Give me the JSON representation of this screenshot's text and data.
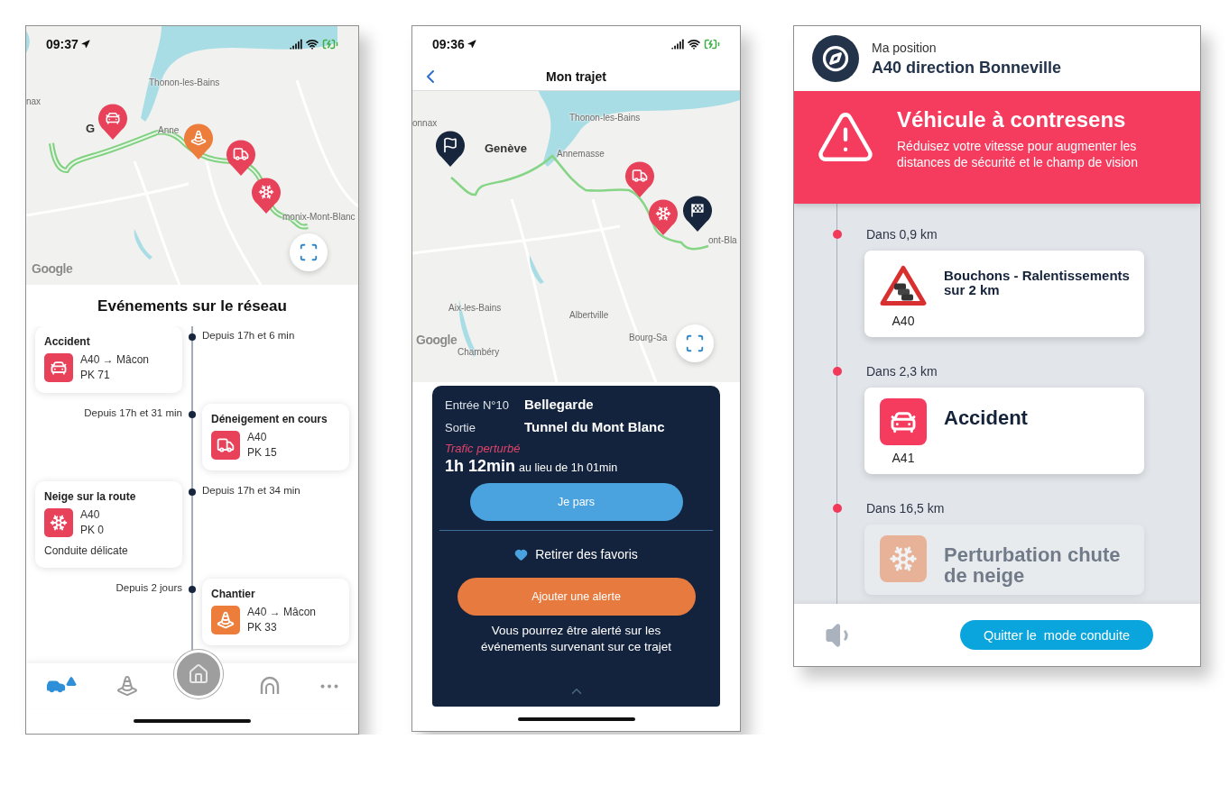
{
  "events_screen": {
    "status_bar": {
      "time": "09:37"
    },
    "map": {
      "labels": [
        {
          "text": "nax",
          "kind": "minor"
        },
        {
          "text": "Thonon-les-Bains",
          "kind": "minor"
        },
        {
          "text": "G",
          "kind": "major"
        },
        {
          "text": "Anne",
          "kind": "minor"
        },
        {
          "text": "monix-Mont-Blanc",
          "kind": "minor"
        }
      ],
      "markers": [
        {
          "kind": "accident"
        },
        {
          "kind": "works"
        },
        {
          "kind": "plow"
        },
        {
          "kind": "snow"
        }
      ],
      "attribution": "Google"
    },
    "title": "Evénements sur le réseau",
    "events": [
      {
        "time": "Depuis 17h et 6 min",
        "title": "Accident",
        "kind": "accident",
        "lines": [
          "A40 → Mâcon",
          "PK 71"
        ]
      },
      {
        "time": "Depuis 17h et 31 min",
        "title": "Déneigement en cours",
        "kind": "plow",
        "lines": [
          "A40",
          "PK 15"
        ]
      },
      {
        "time": "Depuis 17h et 34 min",
        "title": "Neige sur la route",
        "kind": "snow",
        "lines": [
          "A40",
          "PK 0"
        ],
        "note": "Conduite délicate"
      },
      {
        "time": "Depuis 2 jours",
        "title": "Chantier",
        "kind": "works",
        "lines": [
          "A40 → Mâcon",
          "PK 33"
        ]
      }
    ],
    "tabs": [
      {
        "kind": "traffic",
        "selected": true
      },
      {
        "kind": "works",
        "selected": false
      },
      {
        "kind": "home",
        "selected": false
      },
      {
        "kind": "tunnel",
        "selected": false
      },
      {
        "kind": "more",
        "selected": false
      }
    ]
  },
  "trip_screen": {
    "status_bar": {
      "time": "09:36"
    },
    "header": {
      "title": "Mon trajet"
    },
    "map": {
      "labels": [
        {
          "text": "onnax",
          "kind": "minor"
        },
        {
          "text": "Thonon-les-Bains",
          "kind": "minor"
        },
        {
          "text": "Genève",
          "kind": "major"
        },
        {
          "text": "Annemasse",
          "kind": "minor"
        },
        {
          "text": "ont-Bla",
          "kind": "minor"
        },
        {
          "text": "Aix-les-Bains",
          "kind": "minor"
        },
        {
          "text": "Albertville",
          "kind": "minor"
        },
        {
          "text": "Bourg-Sa",
          "kind": "minor"
        },
        {
          "text": "Chambéry",
          "kind": "minor"
        }
      ],
      "markers": [
        {
          "kind": "start"
        },
        {
          "kind": "plow"
        },
        {
          "kind": "snow"
        },
        {
          "kind": "finish"
        }
      ],
      "attribution": "Google"
    },
    "route": {
      "entry_label": "Entrée N°10",
      "entry": "Bellegarde",
      "exit_label": "Sortie",
      "exit": "Tunnel du Mont Blanc",
      "traffic_status": "Trafic perturbé",
      "duration": "1h 12min",
      "usual_duration": "au lieu de 1h 01min"
    },
    "start_button": "Je pars",
    "favorite": {
      "label": "Retirer des favoris",
      "favorited": true
    },
    "alert_button": "Ajouter une alerte",
    "alert_note": "Vous pourrez être alerté sur les événements survenant sur ce trajet"
  },
  "driving_screen": {
    "position": {
      "label": "Ma position",
      "value": "A40 direction Bonneville"
    },
    "alert": {
      "title": "Véhicule à contresens",
      "message": "Réduisez votre vitesse pour augmenter les distances de sécurité et le champ de vision"
    },
    "upcoming": [
      {
        "distance": "Dans 0,9 km",
        "kind": "traffic-jam",
        "title": "Bouchons - Ralentissements sur 2 km",
        "road": "A40",
        "faded": false
      },
      {
        "distance": "Dans 2,3 km",
        "kind": "accident",
        "title": "Accident",
        "road": "A41",
        "faded": false
      },
      {
        "distance": "Dans 16,5 km",
        "kind": "snow",
        "title": "Perturbation chute de neige",
        "faded": true
      }
    ],
    "quit_button": "Quitter le  mode conduite"
  }
}
